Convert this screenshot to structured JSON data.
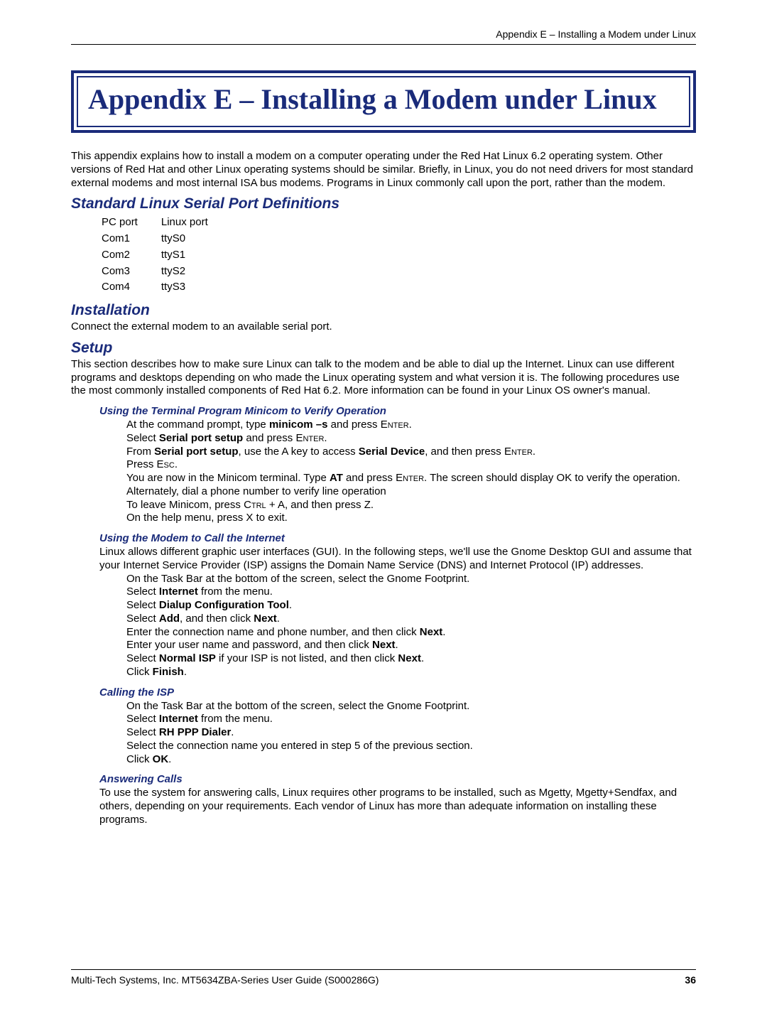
{
  "header": {
    "right": "Appendix E – Installing a Modem under Linux"
  },
  "title": "Appendix E – Installing a Modem under Linux",
  "intro": "This appendix explains how to install a modem on a computer operating under the Red Hat Linux 6.2 operating system. Other versions of Red Hat and other Linux operating systems should be similar. Briefly, in Linux, you do not need drivers for most standard external modems and most internal ISA bus modems. Programs in Linux commonly call upon the port, rather than the modem.",
  "sections": {
    "serial_defs": {
      "heading": "Standard Linux Serial Port Definitions",
      "table_header": {
        "c1": "PC port",
        "c2": "Linux port"
      },
      "rows": [
        {
          "c1": "Com1",
          "c2": "ttyS0"
        },
        {
          "c1": "Com2",
          "c2": "ttyS1"
        },
        {
          "c1": "Com3",
          "c2": "ttyS2"
        },
        {
          "c1": "Com4",
          "c2": "ttyS3"
        }
      ]
    },
    "installation": {
      "heading": "Installation",
      "text": "Connect the external modem to an available serial port."
    },
    "setup": {
      "heading": "Setup",
      "text": "This section describes how to make sure Linux can talk to the modem and be able to dial up the Internet. Linux can use different programs and desktops depending on who made the Linux operating system and what version it is. The following procedures use the most commonly installed components of Red Hat 6.2. More information can be found in your Linux OS owner's manual."
    },
    "minicom": {
      "heading": "Using the Terminal Program Minicom to Verify Operation",
      "l1a": "At the command prompt, type ",
      "l1b": "minicom –s",
      "l1c": " and press ",
      "enter": "Enter",
      "l1d": ".",
      "l2a": "Select ",
      "l2b": "Serial port setup",
      "l2c": " and press ",
      "l3a": "From ",
      "l3b": "Serial port setup",
      "l3c": ", use the A key to access ",
      "l3d": "Serial Device",
      "l3e": ", and then press ",
      "l4a": "Press ",
      "esc": "Esc",
      "l5a": "You are now in the Minicom terminal. Type ",
      "l5b": "AT",
      "l5c": " and press ",
      "l5d": ". The screen should display OK to verify the operation. Alternately, dial a phone number to verify line operation",
      "l6a": "To leave Minicom, press ",
      "ctrl": "Ctrl",
      "l6b": " + A, and then press Z.",
      "l7": "On the help menu, press X to exit."
    },
    "call_internet": {
      "heading": "Using the Modem to Call the Internet",
      "intro": "Linux allows different graphic user interfaces (GUI). In the following steps, we'll use the Gnome Desktop GUI and assume that your Internet Service Provider (ISP) assigns the Domain Name Service (DNS) and Internet Protocol (IP) addresses.",
      "l1": "On the Task Bar at the bottom of the screen, select the Gnome Footprint.",
      "l2a": "Select ",
      "l2b": "Internet",
      "l2c": " from the menu.",
      "l3a": "Select ",
      "l3b": "Dialup Configuration Tool",
      "l3c": ".",
      "l4a": "Select ",
      "l4b": "Add",
      "l4c": ", and then click ",
      "l4d": "Next",
      "l4e": ".",
      "l5a": "Enter the connection name and phone number, and then click ",
      "l5b": "Next",
      "l5c": ".",
      "l6a": "Enter your user name and password, and then click ",
      "l6b": "Next",
      "l6c": ".",
      "l7a": "Select ",
      "l7b": "Normal ISP",
      "l7c": " if your ISP is not listed, and then click ",
      "l7d": "Next",
      "l7e": ".",
      "l8a": "Click ",
      "l8b": "Finish",
      "l8c": "."
    },
    "calling_isp": {
      "heading": "Calling the ISP",
      "l1": "On the Task Bar at the bottom of the screen, select the Gnome Footprint.",
      "l2a": "Select ",
      "l2b": "Internet",
      "l2c": " from the menu.",
      "l3a": "Select ",
      "l3b": "RH PPP Dialer",
      "l3c": ".",
      "l4": "Select the connection name you entered in step 5 of the previous section.",
      "l5a": "Click ",
      "l5b": "OK",
      "l5c": "."
    },
    "answering": {
      "heading": "Answering Calls",
      "text": "To use the system for answering calls, Linux requires other programs to be installed, such as Mgetty, Mgetty+Sendfax, and others, depending on your requirements. Each vendor of Linux has more than adequate information on installing these programs."
    }
  },
  "footer": {
    "left": "Multi-Tech Systems, Inc. MT5634ZBA-Series User Guide (S000286G)",
    "right": "36"
  }
}
